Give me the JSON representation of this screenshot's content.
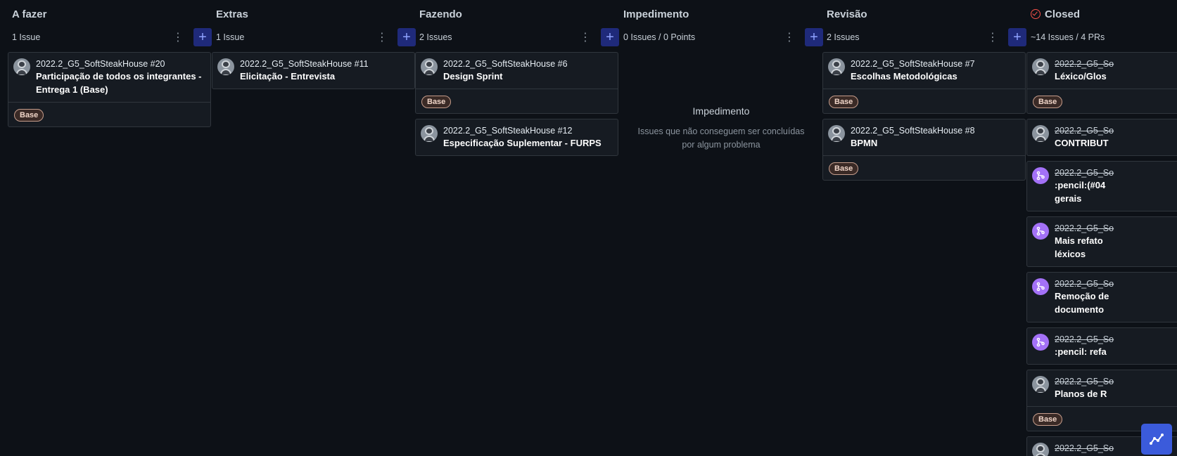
{
  "columns": [
    {
      "name": "A fazer",
      "count": "1 Issue",
      "cards": [
        {
          "ref": "2022.2_G5_SoftSteakHouse #20",
          "title": "Participação de todos os integrantes - Entrega 1 (Base)",
          "label": "Base"
        }
      ]
    },
    {
      "name": "Extras",
      "count": "1 Issue",
      "cards": [
        {
          "ref": "2022.2_G5_SoftSteakHouse #11",
          "title": "Elicitação - Entrevista"
        }
      ]
    },
    {
      "name": "Fazendo",
      "count": "2 Issues",
      "cards": [
        {
          "ref": "2022.2_G5_SoftSteakHouse #6",
          "title": "Design Sprint",
          "label": "Base"
        },
        {
          "ref": "2022.2_G5_SoftSteakHouse #12",
          "title": "Especificação Suplementar - FURPS"
        }
      ]
    },
    {
      "name": "Impedimento",
      "count": "0 Issues / 0 Points",
      "empty_title": "Impedimento",
      "empty_desc": "Issues que não conseguem ser concluídas por algum problema"
    },
    {
      "name": "Revisão",
      "count": "2 Issues",
      "cards": [
        {
          "ref": "2022.2_G5_SoftSteakHouse #7",
          "title": "Escolhas Metodológicas",
          "label": "Base"
        },
        {
          "ref": "2022.2_G5_SoftSteakHouse #8",
          "title": "BPMN",
          "label": "Base"
        }
      ]
    },
    {
      "name": "Closed",
      "count": "~14 Issues / 4 PRs",
      "cards": [
        {
          "ref": "2022.2_G5_So",
          "title": "Léxico/Glos",
          "label": "Base",
          "kind": "issue"
        },
        {
          "ref": "2022.2_G5_So",
          "title": "CONTRIBUT",
          "kind": "issue"
        },
        {
          "ref": "2022.2_G5_So",
          "title": ":pencil:(#04",
          "title2": "gerais",
          "kind": "pr"
        },
        {
          "ref": "2022.2_G5_So",
          "title": "Mais refato",
          "title2": "léxicos",
          "kind": "pr"
        },
        {
          "ref": "2022.2_G5_So",
          "title": "Remoção de",
          "title2": "documento",
          "kind": "pr"
        },
        {
          "ref": "2022.2_G5_So",
          "title": ":pencil: refa",
          "kind": "pr"
        },
        {
          "ref": "2022.2_G5_So",
          "title": "Planos de R",
          "label": "Base",
          "kind": "issue"
        },
        {
          "ref": "2022.2_G5_So",
          "title": "",
          "kind": "issue"
        }
      ]
    }
  ],
  "icons": {
    "kebab": "kebab-menu-icon",
    "add": "plus-icon",
    "closed": "check-circle-icon",
    "fab": "chart-icon"
  },
  "colors": {
    "background": "#0d1117",
    "card": "#161b22",
    "add_button": "#1f2a7a",
    "pr_avatar": "#a371f7",
    "closed_icon": "#f85149",
    "fab": "#3b5bdb"
  }
}
